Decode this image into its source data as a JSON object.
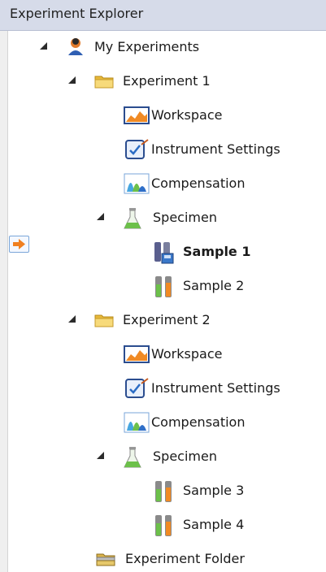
{
  "panel": {
    "title": "Experiment Explorer"
  },
  "tree": {
    "root": "My Experiments",
    "exp1": {
      "label": "Experiment 1",
      "workspace": "Workspace",
      "instrument": "Instrument Settings",
      "compensation": "Compensation",
      "specimen": "Specimen",
      "samples": [
        "Sample 1",
        "Sample 2"
      ]
    },
    "exp2": {
      "label": "Experiment 2",
      "workspace": "Workspace",
      "instrument": "Instrument Settings",
      "compensation": "Compensation",
      "specimen": "Specimen",
      "samples": [
        "Sample 3",
        "Sample 4"
      ]
    },
    "folder": "Experiment Folder"
  },
  "current_item": "Sample 1",
  "colors": {
    "header_bg": "#d6dbe9",
    "selection_arrow": "#f08020",
    "folder_yellow": "#f3cf55",
    "flask_green": "#6cc04a"
  }
}
